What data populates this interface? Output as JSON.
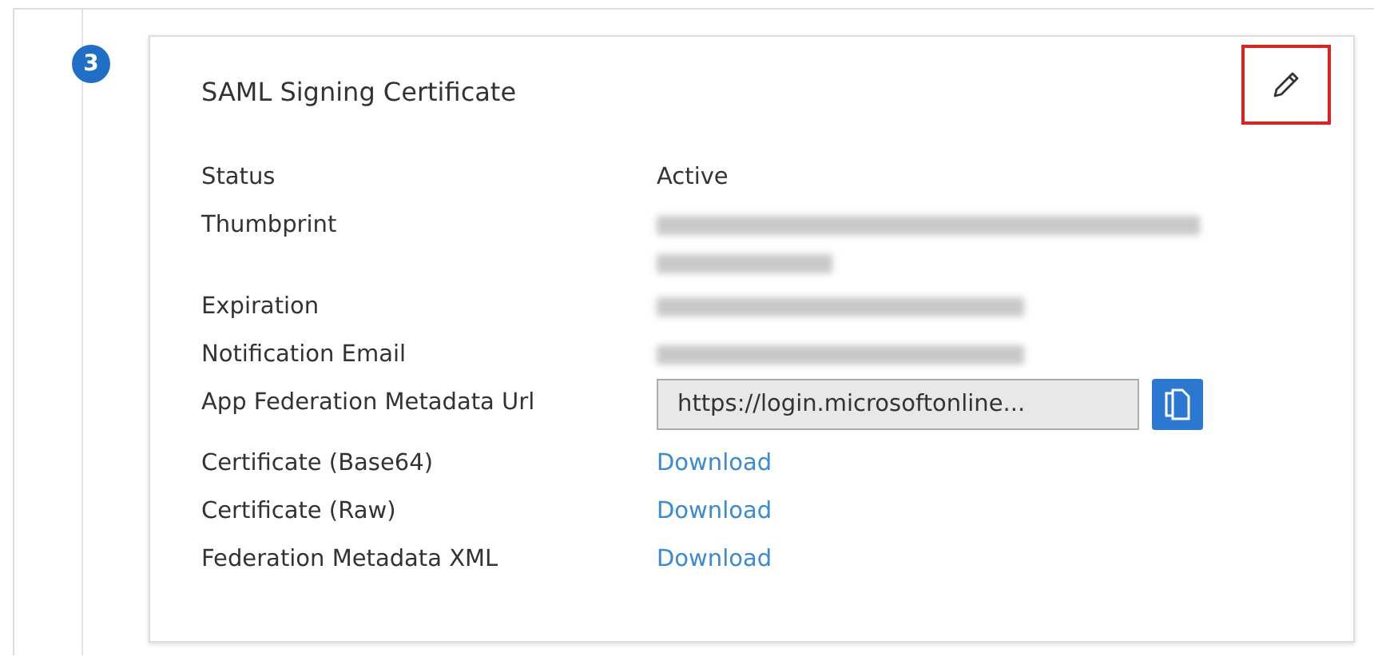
{
  "step": {
    "number": "3"
  },
  "card": {
    "title": "SAML Signing Certificate",
    "rows": [
      {
        "kind": "text",
        "label": "Status",
        "value": "Active"
      },
      {
        "kind": "redacted",
        "label": "Thumbprint",
        "wrapped": true
      },
      {
        "kind": "redacted",
        "label": "Expiration",
        "wrapped": false
      },
      {
        "kind": "redacted",
        "label": "Notification Email",
        "wrapped": false
      },
      {
        "kind": "url",
        "label": "App Federation Metadata Url",
        "value": "https://login.microsoftonline..."
      },
      {
        "kind": "link",
        "label": "Certificate (Base64)",
        "value": "Download"
      },
      {
        "kind": "link",
        "label": "Certificate (Raw)",
        "value": "Download"
      },
      {
        "kind": "link",
        "label": "Federation Metadata XML",
        "value": "Download"
      }
    ]
  }
}
